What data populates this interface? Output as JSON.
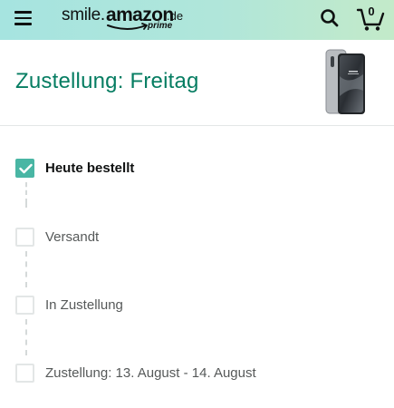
{
  "header": {
    "logo": {
      "smile": "smile.",
      "amazon": "amazon",
      "tld": ".de",
      "prime": "prime"
    },
    "icons": {
      "menu": "hamburger-menu-icon",
      "search": "search-icon",
      "cart": "cart-icon"
    },
    "cart_count": "0",
    "colors": {
      "gradient_start": "#a6e4e0",
      "gradient_end": "#c3eac9"
    }
  },
  "delivery": {
    "title": "Zustellung: Freitag",
    "title_color": "#067d62",
    "product_image": "smartphone-product-image"
  },
  "steps": [
    {
      "label": "Heute bestellt",
      "done": true
    },
    {
      "label": "Versandt",
      "done": false
    },
    {
      "label": "In Zustellung",
      "done": false
    },
    {
      "label": "Zustellung: 13. August - 14. August",
      "done": false
    }
  ],
  "colors": {
    "checkbox_done": "#49b6a4",
    "checkbox_border": "#e3e6e6",
    "connector": "#d5d9d9"
  }
}
